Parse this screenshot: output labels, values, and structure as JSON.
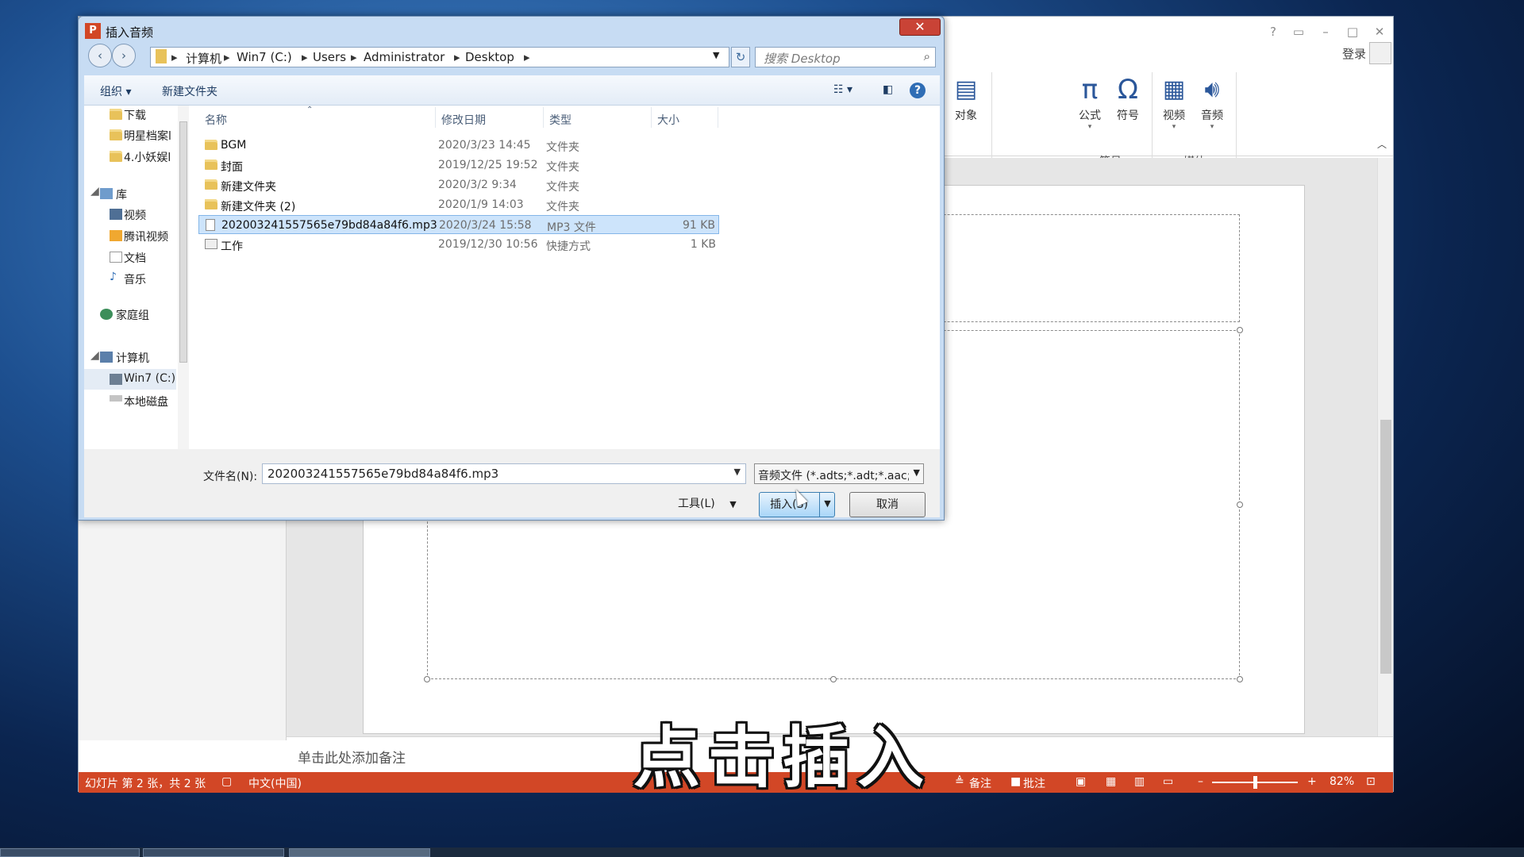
{
  "powerpoint": {
    "login_label": "登录",
    "ribbon": {
      "buttons": {
        "object": "对象",
        "equation": "公式",
        "symbol": "符号",
        "video": "视频",
        "audio": "音频"
      },
      "groups": {
        "symbols": "符号",
        "media": "媒体"
      }
    },
    "notes_placeholder": "单击此处添加备注",
    "status": {
      "slide_info": "幻灯片 第 2 张，共 2 张",
      "language": "中文(中国)",
      "notes": "备注",
      "comments": "批注",
      "zoom": "82%"
    }
  },
  "dialog": {
    "title": "插入音频",
    "breadcrumb": [
      "计算机",
      "Win7 (C:)",
      "Users",
      "Administrator",
      "Desktop"
    ],
    "search_placeholder": "搜索 Desktop",
    "toolbar": {
      "organize": "组织 ▾",
      "new_folder": "新建文件夹"
    },
    "nav": {
      "items": [
        "下载",
        "明星档案l",
        "4.小妖娱l",
        "库",
        "视频",
        "腾讯视频",
        "文档",
        "音乐",
        "家庭组",
        "计算机",
        "Win7 (C:)",
        "本地磁盘"
      ]
    },
    "columns": {
      "name": "名称",
      "date": "修改日期",
      "type": "类型",
      "size": "大小"
    },
    "files": [
      {
        "name": "BGM",
        "date": "2020/3/23 14:45",
        "type": "文件夹",
        "size": ""
      },
      {
        "name": "封面",
        "date": "2019/12/25 19:52",
        "type": "文件夹",
        "size": ""
      },
      {
        "name": "新建文件夹",
        "date": "2020/3/2 9:34",
        "type": "文件夹",
        "size": ""
      },
      {
        "name": "新建文件夹 (2)",
        "date": "2020/1/9 14:03",
        "type": "文件夹",
        "size": ""
      },
      {
        "name": "202003241557565e79bd84a84f6.mp3",
        "date": "2020/3/24 15:58",
        "type": "MP3 文件",
        "size": "91 KB"
      },
      {
        "name": "工作",
        "date": "2019/12/30 10:56",
        "type": "快捷方式",
        "size": "1 KB"
      }
    ],
    "filename_label": "文件名(N):",
    "filename_value": "202003241557565e79bd84a84f6.mp3",
    "filetype": "音频文件 (*.adts;*.adt;*.aac;*.a",
    "tools_label": "工具(L)",
    "insert_label": "插入(S)",
    "cancel_label": "取消"
  },
  "caption": "点击插入",
  "colors": {
    "accent": "#d24726",
    "selection": "#cde4fb",
    "dialog_frame": "#c7dcf3"
  }
}
